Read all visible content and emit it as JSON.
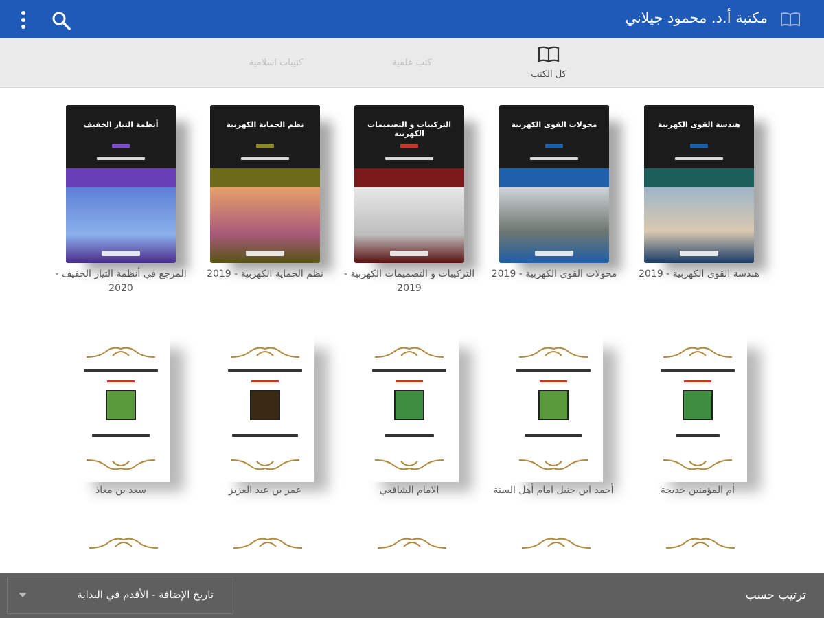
{
  "appbar": {
    "title": "مكتبة أ.د. محمود جيلاني"
  },
  "tabs": [
    {
      "label": "كل الكتب"
    },
    {
      "label": "كتب علمية"
    },
    {
      "label": "كتيبات اسلامية"
    }
  ],
  "books": [
    {
      "cover_title": "هندسة القوى الكهربية",
      "caption": "هندسة القوى الكهربية - 2019",
      "accent": "#1b5e5a"
    },
    {
      "cover_title": "محولات القوى الكهربية",
      "caption": "محولات القوى الكهربية - 2019",
      "accent": "#1d5fa8"
    },
    {
      "cover_title": "التركيبات و التصميمات الكهربية",
      "caption": "التركيبات و التصميمات الكهربية - 2019",
      "accent": "#7a1a1a"
    },
    {
      "cover_title": "نظم الحماية الكهربية",
      "caption": "نظم الحماية الكهربية - 2019",
      "accent": "#6b6b1a"
    },
    {
      "cover_title": "أنظمة التيار الخفيف",
      "caption": "المرجع في أنظمة التيار الخفيف - 2020",
      "accent": "#6a3fb5"
    }
  ],
  "booklets": [
    {
      "caption": "أم المؤمنين خديجة"
    },
    {
      "caption": "أحمد ابن حنبل امام أهل السنة"
    },
    {
      "caption": "الامام الشافعي"
    },
    {
      "caption": "عمر بن عبد العزيز"
    },
    {
      "caption": "سعد بن معاذ"
    }
  ],
  "sort": {
    "label": "ترتيب حسب",
    "value": "تاريخ الإضافة - الأقدم في البداية"
  },
  "icons": {
    "logo": "book-open-icon",
    "search": "search-icon",
    "menu": "more-vert-icon",
    "tab": "book-open-icon",
    "dropdown": "caret-down-icon"
  },
  "colors": {
    "appbar": "#1f5ab8",
    "tabs_bg": "#eaeaea",
    "bottombar": "#5f5f5f"
  }
}
